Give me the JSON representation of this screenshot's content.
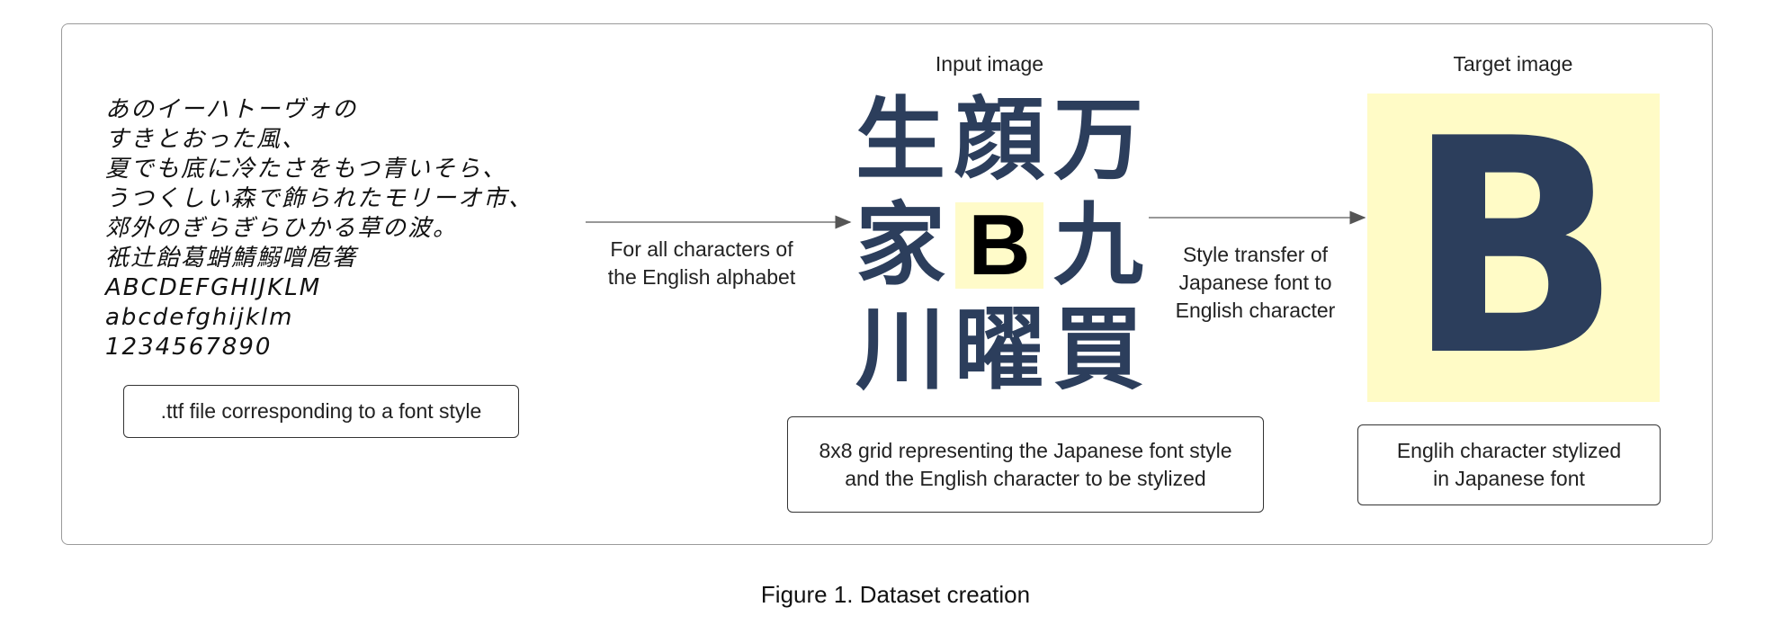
{
  "sample_text": {
    "lines": [
      "あのイーハトーヴォの",
      "すきとおった風、",
      "夏でも底に冷たさをもつ青いそら、",
      "うつくしい森で飾られたモリーオ市、",
      "郊外のぎらぎらひかる草の波。",
      "祇辻飴葛蛸鯖鰯噌庖箸",
      "ABCDEFGHIJKLM",
      "abcdefghijklm",
      "1234567890"
    ]
  },
  "ttf_box": {
    "label": ".ttf file corresponding to a font style"
  },
  "arrow1_label": {
    "line1": "For all characters of",
    "line2": "the English alphabet"
  },
  "input_title": "Input image",
  "grid": {
    "chars": [
      "生",
      "顔",
      "万",
      "家",
      "B",
      "九",
      "川",
      "曜",
      "買"
    ]
  },
  "grid_box": {
    "line1": "8x8 grid representing the Japanese font style",
    "line2": "and the English character to be stylized"
  },
  "arrow2_label": {
    "line1": "Style transfer of",
    "line2": "Japanese font to",
    "line3": "English character"
  },
  "target_title": "Target image",
  "target_char": "B",
  "target_box": {
    "line1": "Englih character stylized",
    "line2": "in Japanese font"
  },
  "caption": "Figure 1. Dataset creation",
  "colors": {
    "glyph": "#2c3e5c",
    "highlight": "#fffbc9",
    "border": "#9a9a9a"
  }
}
